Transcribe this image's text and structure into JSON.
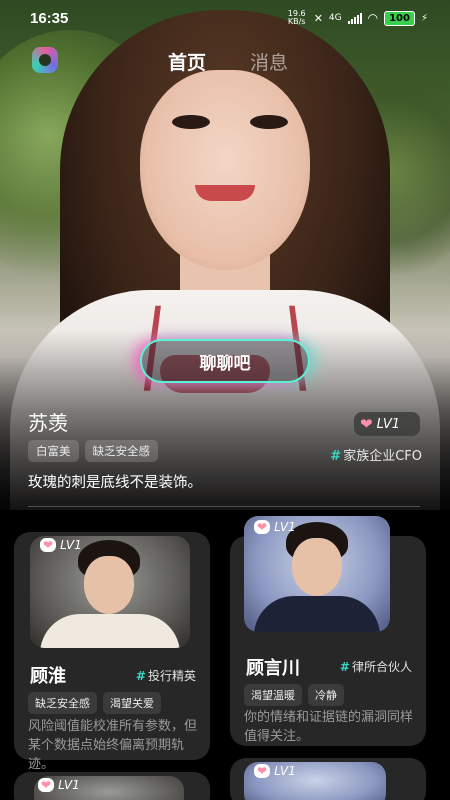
{
  "status_bar": {
    "time": "16:35",
    "net_speed": "19.6 KB/s",
    "network": "4G",
    "battery": "100"
  },
  "nav": {
    "tabs": [
      "首页",
      "消息"
    ],
    "active": "首页"
  },
  "hero": {
    "chat_button": "聊聊吧",
    "name": "苏羡",
    "level": "LV1",
    "tags": [
      "白富美",
      "缺乏安全感"
    ],
    "role": "家族企业CFO",
    "quote": "玫瑰的刺是底线不是装饰。"
  },
  "cards": [
    {
      "name": "顾淮",
      "level": "LV1",
      "role": "投行精英",
      "tags": [
        "缺乏安全感",
        "渴望关爱"
      ],
      "description": "风险阈值能校准所有参数，但某个数据点始终偏离预期轨迹。"
    },
    {
      "name": "顾言川",
      "level": "LV1",
      "role": "律所合伙人",
      "tags": [
        "渴望温暖",
        "冷静"
      ],
      "description": "你的情绪和证据链的漏洞同样值得关注。"
    },
    {
      "level": "LV1"
    },
    {
      "level": "LV1"
    }
  ],
  "colors": {
    "accent_teal": "#38d6c2",
    "accent_pink": "#ff5bb0",
    "battery_green": "#36d04a"
  }
}
